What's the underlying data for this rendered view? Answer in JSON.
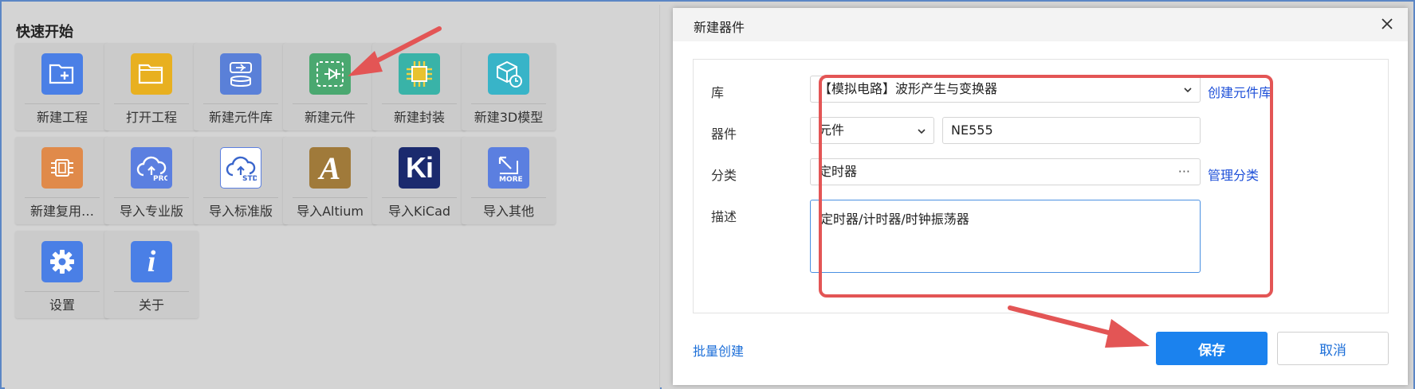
{
  "quick_start": {
    "title": "快速开始",
    "tiles": [
      {
        "label": "新建工程",
        "icon": "new-project-icon",
        "color": "#4a7fe6"
      },
      {
        "label": "打开工程",
        "icon": "open-folder-icon",
        "color": "#e8b020"
      },
      {
        "label": "新建元件库",
        "icon": "component-library-icon",
        "color": "#5a80d8"
      },
      {
        "label": "新建元件",
        "icon": "new-component-icon",
        "color": "#4aa870"
      },
      {
        "label": "新建封装",
        "icon": "footprint-icon",
        "color": "#39b3a8"
      },
      {
        "label": "新建3D模型",
        "icon": "3d-model-icon",
        "color": "#38b4c8"
      },
      {
        "label": "新建复用…",
        "icon": "reuse-block-icon",
        "color": "#e08a4a"
      },
      {
        "label": "导入专业版",
        "icon": "cloud-pro-icon",
        "color": "#5b7fe0"
      },
      {
        "label": "导入标准版",
        "icon": "cloud-std-icon",
        "color": "#ffffff"
      },
      {
        "label": "导入Altium",
        "icon": "altium-icon",
        "color": "#a07a3a"
      },
      {
        "label": "导入KiCad",
        "icon": "kicad-icon",
        "color": "#1b2a6e"
      },
      {
        "label": "导入其他",
        "icon": "import-more-icon",
        "color": "#5b7fe0"
      },
      {
        "label": "设置",
        "icon": "settings-gear-icon",
        "color": "#4a7fe6"
      },
      {
        "label": "关于",
        "icon": "info-icon",
        "color": "#4a7fe6"
      }
    ],
    "pro_badge": "PRO",
    "std_badge": "STD",
    "more_badge": "MORE",
    "kicad_text": "Ki",
    "altium_text": "A",
    "info_text": "i"
  },
  "dialog": {
    "title": "新建器件",
    "library_label": "库",
    "library_value": "【模拟电路】波形产生与变换器",
    "create_library_link": "创建元件库",
    "device_label": "器件",
    "device_type_value": "元件",
    "device_name_value": "NE555",
    "category_label": "分类",
    "category_value": "定时器",
    "category_more": "···",
    "manage_category_link": "管理分类",
    "description_label": "描述",
    "description_value": "定时器/计时器/时钟振荡器",
    "batch_create_link": "批量创建",
    "save_label": "保存",
    "cancel_label": "取消"
  },
  "colors": {
    "highlight_red": "#e35555",
    "primary_blue": "#1b82ee",
    "link_blue": "#1d4fd8"
  }
}
